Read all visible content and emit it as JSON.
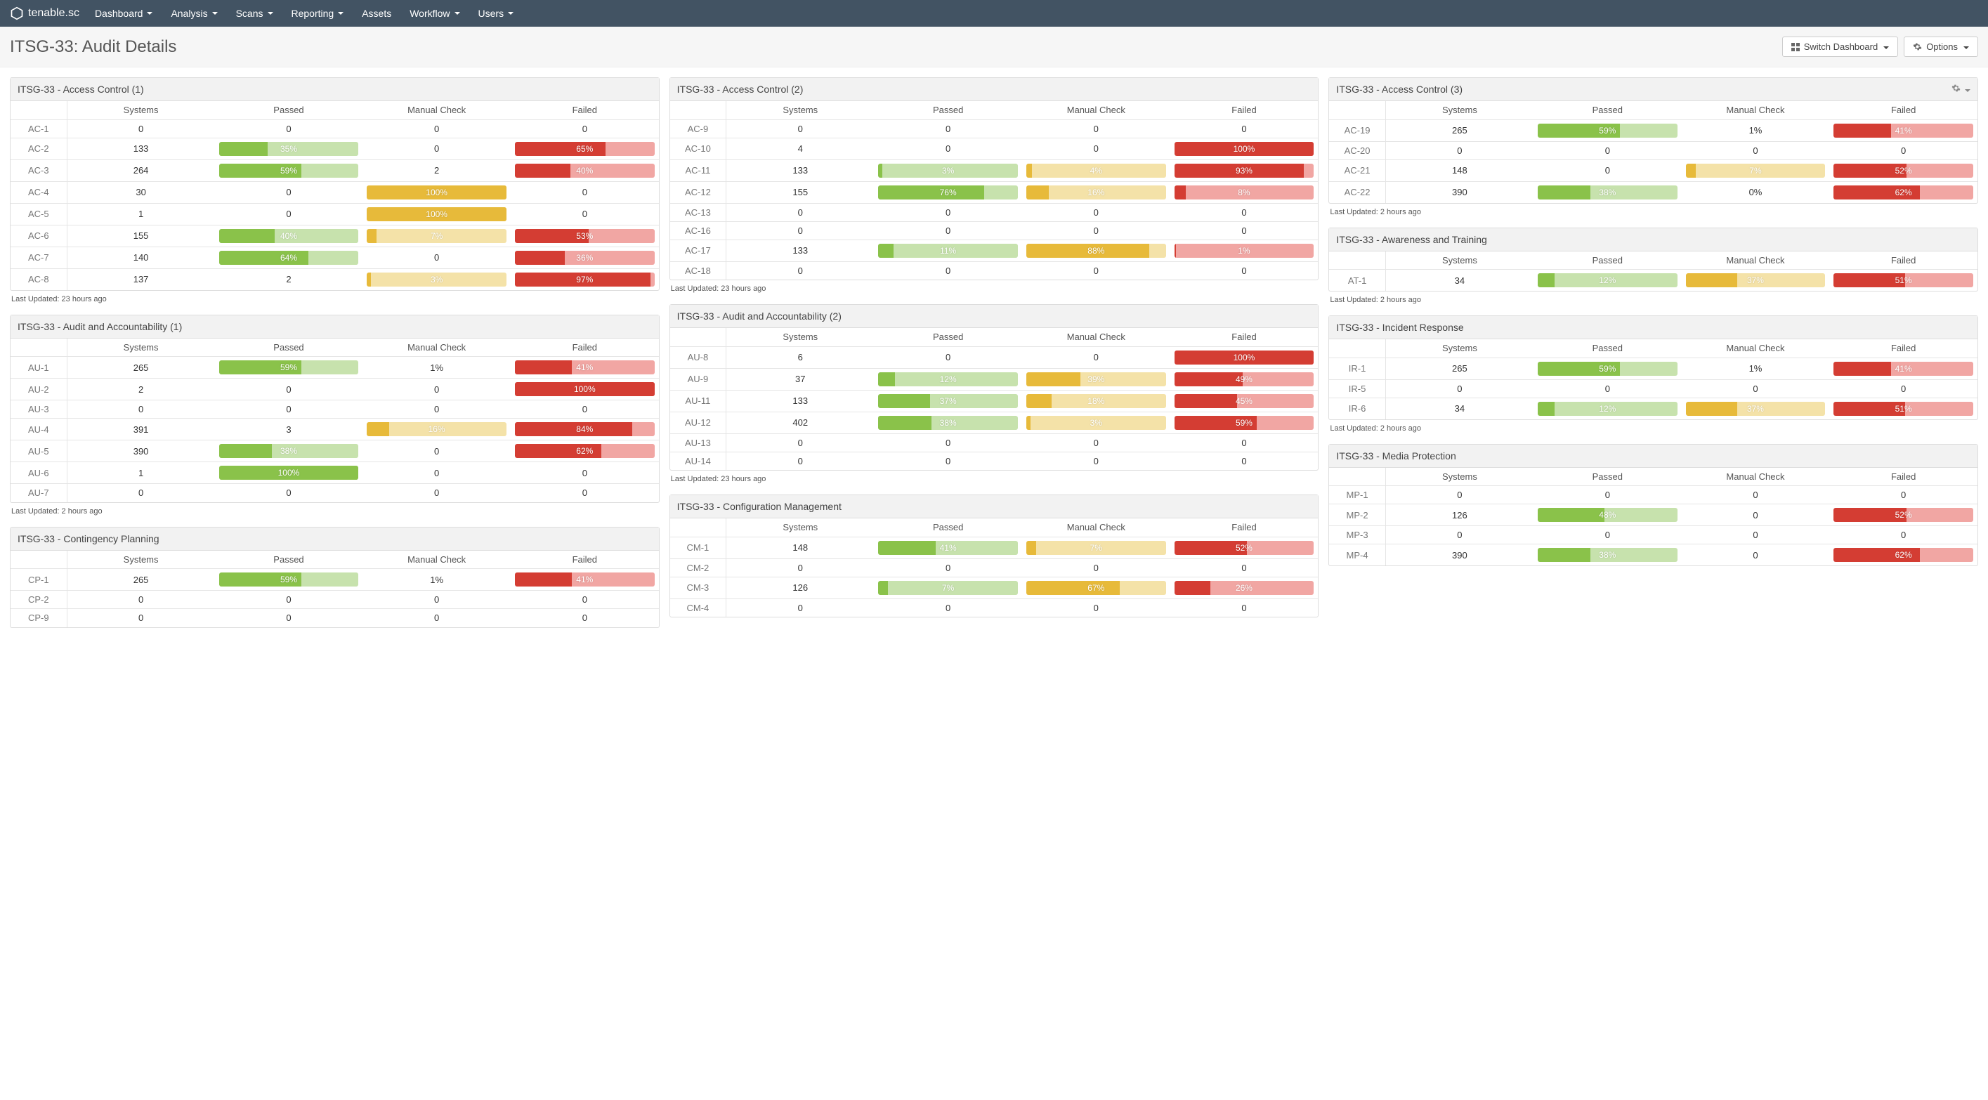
{
  "nav": {
    "brand": "tenable.sc",
    "links": [
      "Dashboard",
      "Analysis",
      "Scans",
      "Reporting",
      "Assets",
      "Workflow",
      "Users"
    ],
    "link_has_caret": [
      true,
      true,
      true,
      true,
      false,
      true,
      true
    ]
  },
  "header": {
    "title": "ITSG-33: Audit Details",
    "switch_label": "Switch Dashboard",
    "options_label": "Options"
  },
  "columns_headers": [
    "",
    "Systems",
    "Passed",
    "Manual Check",
    "Failed"
  ],
  "panels": [
    [
      {
        "title": "ITSG-33 - Access Control (1)",
        "updated": "Last Updated: 23 hours ago",
        "rows": [
          {
            "id": "AC-1",
            "sys": "0",
            "pass": {
              "v": "0"
            },
            "man": {
              "v": "0"
            },
            "fail": {
              "v": "0"
            }
          },
          {
            "id": "AC-2",
            "sys": "133",
            "pass": {
              "v": "35%",
              "p": 35
            },
            "man": {
              "v": "0"
            },
            "fail": {
              "v": "65%",
              "p": 65
            }
          },
          {
            "id": "AC-3",
            "sys": "264",
            "pass": {
              "v": "59%",
              "p": 59
            },
            "man": {
              "v": "2"
            },
            "fail": {
              "v": "40%",
              "p": 40
            }
          },
          {
            "id": "AC-4",
            "sys": "30",
            "pass": {
              "v": "0"
            },
            "man": {
              "v": "100%",
              "p": 100
            },
            "fail": {
              "v": "0"
            }
          },
          {
            "id": "AC-5",
            "sys": "1",
            "pass": {
              "v": "0"
            },
            "man": {
              "v": "100%",
              "p": 100
            },
            "fail": {
              "v": "0"
            }
          },
          {
            "id": "AC-6",
            "sys": "155",
            "pass": {
              "v": "40%",
              "p": 40
            },
            "man": {
              "v": "7%",
              "p": 7
            },
            "fail": {
              "v": "53%",
              "p": 53
            }
          },
          {
            "id": "AC-7",
            "sys": "140",
            "pass": {
              "v": "64%",
              "p": 64
            },
            "man": {
              "v": "0"
            },
            "fail": {
              "v": "36%",
              "p": 36
            }
          },
          {
            "id": "AC-8",
            "sys": "137",
            "pass": {
              "v": "2"
            },
            "man": {
              "v": "3%",
              "p": 3
            },
            "fail": {
              "v": "97%",
              "p": 97
            }
          }
        ]
      },
      {
        "title": "ITSG-33 - Audit and Accountability (1)",
        "updated": "Last Updated: 2 hours ago",
        "rows": [
          {
            "id": "AU-1",
            "sys": "265",
            "pass": {
              "v": "59%",
              "p": 59
            },
            "man": {
              "v": "1%"
            },
            "fail": {
              "v": "41%",
              "p": 41
            }
          },
          {
            "id": "AU-2",
            "sys": "2",
            "pass": {
              "v": "0"
            },
            "man": {
              "v": "0"
            },
            "fail": {
              "v": "100%",
              "p": 100
            }
          },
          {
            "id": "AU-3",
            "sys": "0",
            "pass": {
              "v": "0"
            },
            "man": {
              "v": "0"
            },
            "fail": {
              "v": "0"
            }
          },
          {
            "id": "AU-4",
            "sys": "391",
            "pass": {
              "v": "3"
            },
            "man": {
              "v": "16%",
              "p": 16
            },
            "fail": {
              "v": "84%",
              "p": 84
            }
          },
          {
            "id": "AU-5",
            "sys": "390",
            "pass": {
              "v": "38%",
              "p": 38
            },
            "man": {
              "v": "0"
            },
            "fail": {
              "v": "62%",
              "p": 62
            }
          },
          {
            "id": "AU-6",
            "sys": "1",
            "pass": {
              "v": "100%",
              "p": 100
            },
            "man": {
              "v": "0"
            },
            "fail": {
              "v": "0"
            }
          },
          {
            "id": "AU-7",
            "sys": "0",
            "pass": {
              "v": "0"
            },
            "man": {
              "v": "0"
            },
            "fail": {
              "v": "0"
            }
          }
        ]
      },
      {
        "title": "ITSG-33 - Contingency Planning",
        "rows": [
          {
            "id": "CP-1",
            "sys": "265",
            "pass": {
              "v": "59%",
              "p": 59
            },
            "man": {
              "v": "1%"
            },
            "fail": {
              "v": "41%",
              "p": 41
            }
          },
          {
            "id": "CP-2",
            "sys": "0",
            "pass": {
              "v": "0"
            },
            "man": {
              "v": "0"
            },
            "fail": {
              "v": "0"
            }
          },
          {
            "id": "CP-9",
            "sys": "0",
            "pass": {
              "v": "0"
            },
            "man": {
              "v": "0"
            },
            "fail": {
              "v": "0"
            }
          }
        ]
      }
    ],
    [
      {
        "title": "ITSG-33 - Access Control (2)",
        "updated": "Last Updated: 23 hours ago",
        "rows": [
          {
            "id": "AC-9",
            "sys": "0",
            "pass": {
              "v": "0"
            },
            "man": {
              "v": "0"
            },
            "fail": {
              "v": "0"
            }
          },
          {
            "id": "AC-10",
            "sys": "4",
            "pass": {
              "v": "0"
            },
            "man": {
              "v": "0"
            },
            "fail": {
              "v": "100%",
              "p": 100
            }
          },
          {
            "id": "AC-11",
            "sys": "133",
            "pass": {
              "v": "3%",
              "p": 3
            },
            "man": {
              "v": "4%",
              "p": 4
            },
            "fail": {
              "v": "93%",
              "p": 93
            }
          },
          {
            "id": "AC-12",
            "sys": "155",
            "pass": {
              "v": "76%",
              "p": 76
            },
            "man": {
              "v": "16%",
              "p": 16
            },
            "fail": {
              "v": "8%",
              "p": 8
            }
          },
          {
            "id": "AC-13",
            "sys": "0",
            "pass": {
              "v": "0"
            },
            "man": {
              "v": "0"
            },
            "fail": {
              "v": "0"
            }
          },
          {
            "id": "AC-16",
            "sys": "0",
            "pass": {
              "v": "0"
            },
            "man": {
              "v": "0"
            },
            "fail": {
              "v": "0"
            }
          },
          {
            "id": "AC-17",
            "sys": "133",
            "pass": {
              "v": "11%",
              "p": 11
            },
            "man": {
              "v": "88%",
              "p": 88
            },
            "fail": {
              "v": "1%",
              "p": 1
            }
          },
          {
            "id": "AC-18",
            "sys": "0",
            "pass": {
              "v": "0"
            },
            "man": {
              "v": "0"
            },
            "fail": {
              "v": "0"
            }
          }
        ]
      },
      {
        "title": "ITSG-33 - Audit and Accountability (2)",
        "updated": "Last Updated: 23 hours ago",
        "rows": [
          {
            "id": "AU-8",
            "sys": "6",
            "pass": {
              "v": "0"
            },
            "man": {
              "v": "0"
            },
            "fail": {
              "v": "100%",
              "p": 100
            }
          },
          {
            "id": "AU-9",
            "sys": "37",
            "pass": {
              "v": "12%",
              "p": 12
            },
            "man": {
              "v": "39%",
              "p": 39
            },
            "fail": {
              "v": "49%",
              "p": 49
            }
          },
          {
            "id": "AU-11",
            "sys": "133",
            "pass": {
              "v": "37%",
              "p": 37
            },
            "man": {
              "v": "18%",
              "p": 18
            },
            "fail": {
              "v": "45%",
              "p": 45
            }
          },
          {
            "id": "AU-12",
            "sys": "402",
            "pass": {
              "v": "38%",
              "p": 38
            },
            "man": {
              "v": "3%",
              "p": 3
            },
            "fail": {
              "v": "59%",
              "p": 59
            }
          },
          {
            "id": "AU-13",
            "sys": "0",
            "pass": {
              "v": "0"
            },
            "man": {
              "v": "0"
            },
            "fail": {
              "v": "0"
            }
          },
          {
            "id": "AU-14",
            "sys": "0",
            "pass": {
              "v": "0"
            },
            "man": {
              "v": "0"
            },
            "fail": {
              "v": "0"
            }
          }
        ]
      },
      {
        "title": "ITSG-33 - Configuration Management",
        "rows": [
          {
            "id": "CM-1",
            "sys": "148",
            "pass": {
              "v": "41%",
              "p": 41
            },
            "man": {
              "v": "7%",
              "p": 7
            },
            "fail": {
              "v": "52%",
              "p": 52
            }
          },
          {
            "id": "CM-2",
            "sys": "0",
            "pass": {
              "v": "0"
            },
            "man": {
              "v": "0"
            },
            "fail": {
              "v": "0"
            }
          },
          {
            "id": "CM-3",
            "sys": "126",
            "pass": {
              "v": "7%",
              "p": 7
            },
            "man": {
              "v": "67%",
              "p": 67
            },
            "fail": {
              "v": "26%",
              "p": 26
            }
          },
          {
            "id": "CM-4",
            "sys": "0",
            "pass": {
              "v": "0"
            },
            "man": {
              "v": "0"
            },
            "fail": {
              "v": "0"
            }
          }
        ]
      }
    ],
    [
      {
        "title": "ITSG-33 - Access Control (3)",
        "cog": true,
        "updated": "Last Updated: 2 hours ago",
        "rows": [
          {
            "id": "AC-19",
            "sys": "265",
            "pass": {
              "v": "59%",
              "p": 59
            },
            "man": {
              "v": "1%"
            },
            "fail": {
              "v": "41%",
              "p": 41
            }
          },
          {
            "id": "AC-20",
            "sys": "0",
            "pass": {
              "v": "0"
            },
            "man": {
              "v": "0"
            },
            "fail": {
              "v": "0"
            }
          },
          {
            "id": "AC-21",
            "sys": "148",
            "pass": {
              "v": "0"
            },
            "man": {
              "v": "7%",
              "p": 7
            },
            "fail": {
              "v": "52%",
              "p": 52
            }
          },
          {
            "id": "AC-22",
            "sys": "390",
            "pass": {
              "v": "38%",
              "p": 38
            },
            "man": {
              "v": "0%"
            },
            "fail": {
              "v": "62%",
              "p": 62
            }
          }
        ]
      },
      {
        "title": "ITSG-33 - Awareness and Training",
        "updated": "Last Updated: 2 hours ago",
        "rows": [
          {
            "id": "AT-1",
            "sys": "34",
            "pass": {
              "v": "12%",
              "p": 12
            },
            "man": {
              "v": "37%",
              "p": 37
            },
            "fail": {
              "v": "51%",
              "p": 51
            }
          }
        ]
      },
      {
        "title": "ITSG-33 - Incident Response",
        "updated": "Last Updated: 2 hours ago",
        "rows": [
          {
            "id": "IR-1",
            "sys": "265",
            "pass": {
              "v": "59%",
              "p": 59
            },
            "man": {
              "v": "1%"
            },
            "fail": {
              "v": "41%",
              "p": 41
            }
          },
          {
            "id": "IR-5",
            "sys": "0",
            "pass": {
              "v": "0"
            },
            "man": {
              "v": "0"
            },
            "fail": {
              "v": "0"
            }
          },
          {
            "id": "IR-6",
            "sys": "34",
            "pass": {
              "v": "12%",
              "p": 12
            },
            "man": {
              "v": "37%",
              "p": 37
            },
            "fail": {
              "v": "51%",
              "p": 51
            }
          }
        ]
      },
      {
        "title": "ITSG-33 - Media Protection",
        "rows": [
          {
            "id": "MP-1",
            "sys": "0",
            "pass": {
              "v": "0"
            },
            "man": {
              "v": "0"
            },
            "fail": {
              "v": "0"
            }
          },
          {
            "id": "MP-2",
            "sys": "126",
            "pass": {
              "v": "48%",
              "p": 48
            },
            "man": {
              "v": "0"
            },
            "fail": {
              "v": "52%",
              "p": 52
            }
          },
          {
            "id": "MP-3",
            "sys": "0",
            "pass": {
              "v": "0"
            },
            "man": {
              "v": "0"
            },
            "fail": {
              "v": "0"
            }
          },
          {
            "id": "MP-4",
            "sys": "390",
            "pass": {
              "v": "38%",
              "p": 38
            },
            "man": {
              "v": "0"
            },
            "fail": {
              "v": "62%",
              "p": 62
            }
          }
        ]
      }
    ]
  ]
}
